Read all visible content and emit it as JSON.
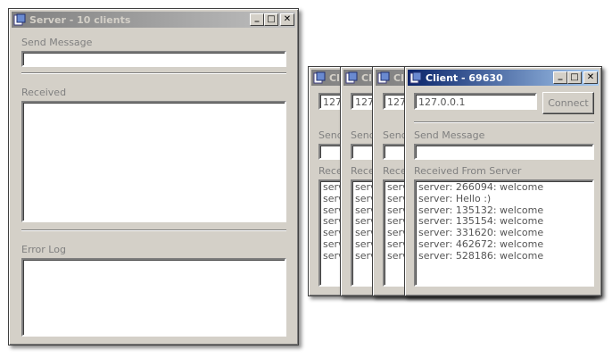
{
  "server": {
    "title": "Server - 10 clients",
    "send_message_label": "Send Message",
    "send_message_value": "",
    "received_label": "Received",
    "error_log_label": "Error Log"
  },
  "stack_clients": [
    {
      "title": "Cli",
      "host": "127.",
      "send_label": "Send",
      "received_label": "Rece",
      "lines": [
        "serv",
        "serv",
        "serv",
        "serv",
        "serv",
        "serv",
        "serv"
      ]
    },
    {
      "title": "Cli",
      "host": "127.",
      "send_label": "Send",
      "received_label": "Rece",
      "lines": [
        "serv",
        "serv",
        "serv",
        "serv",
        "serv",
        "serv",
        "serv"
      ]
    },
    {
      "title": "Cli",
      "host": "127.",
      "send_label": "Send",
      "received_label": "Rece",
      "lines": [
        "serv",
        "serv",
        "serv",
        "serv",
        "serv",
        "serv",
        "serv"
      ]
    }
  ],
  "client": {
    "title": "Client - 69630",
    "host": "127.0.0.1",
    "connect_label": "Connect",
    "send_message_label": "Send Message",
    "send_message_value": "",
    "received_label": "Received From Server",
    "received_lines": [
      "server: 266094: welcome",
      "server: Hello :)",
      "server: 135132: welcome",
      "server: 135154: welcome",
      "server: 331620: welcome",
      "server: 462672: welcome",
      "server: 528186: welcome"
    ]
  },
  "titlebar_buttons": {
    "minimize": "_",
    "maximize": "□",
    "close": "✕"
  },
  "colors": {
    "face": "#d4d0c8",
    "active_title": "#0a246a",
    "inactive_title": "#808080"
  }
}
